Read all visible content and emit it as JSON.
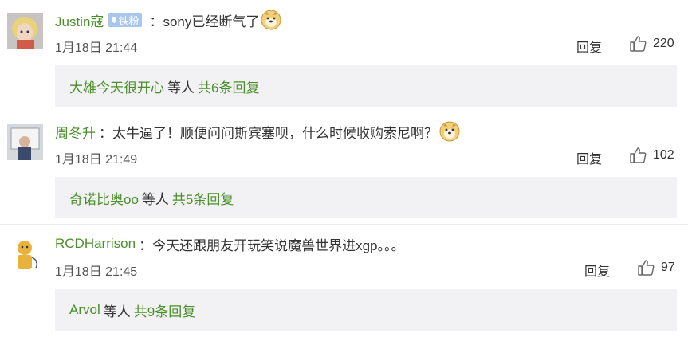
{
  "comments": [
    {
      "username": "Justin寇",
      "badge": "铁粉",
      "colon": "：",
      "text": "sony已经断气了",
      "emoji": "doge-emoji",
      "date": "1月18日 21:44",
      "reply_label": "回复",
      "likes": "220",
      "replies_preview": {
        "who": "大雄今天很开心",
        "etc": "等人",
        "total": "共6条回复"
      }
    },
    {
      "username": "周冬升",
      "colon": "：",
      "text": "太牛逼了！顺便问问斯宾塞呗，什么时候收购索尼啊？",
      "emoji": "doge-emoji",
      "date": "1月18日 21:49",
      "reply_label": "回复",
      "likes": "102",
      "replies_preview": {
        "who": "奇诺比奥oo",
        "etc": "等人",
        "total": "共5条回复"
      }
    },
    {
      "username": "RCDHarrison",
      "colon": "：",
      "text": "今天还跟朋友开玩笑说魔兽世界进xgp。。。",
      "date": "1月18日 21:45",
      "reply_label": "回复",
      "likes": "97",
      "replies_preview": {
        "who": "Arvol",
        "etc": "等人",
        "total": "共9条回复"
      }
    }
  ],
  "colors": {
    "username": "#4a8f2a",
    "badge": "#a9c7ec",
    "reply_box": "#f2f2f5"
  }
}
